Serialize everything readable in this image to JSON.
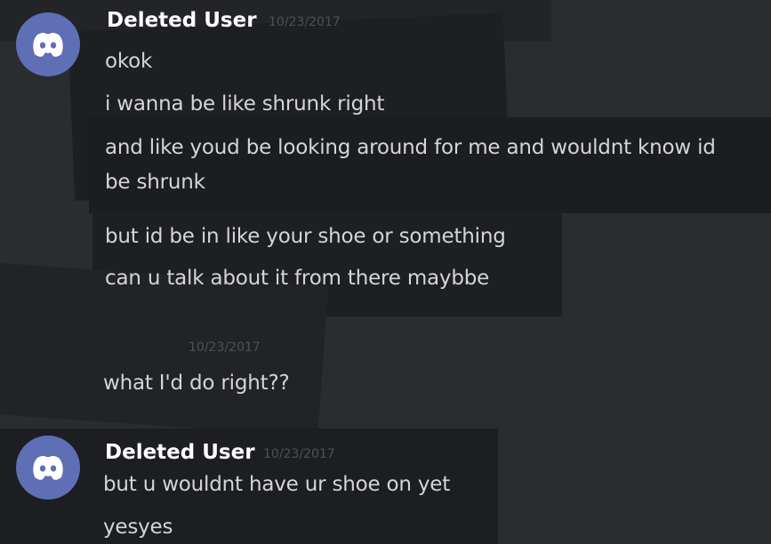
{
  "messages": [
    {
      "author": "Deleted User",
      "timestamp": "10/23/2017",
      "lines": [
        "okok",
        "i wanna be like shrunk right",
        "and like youd be looking around for me and wouldnt know id",
        "be shrunk",
        "but id be in like your shoe or something",
        "can u talk about it from there maybbe"
      ]
    },
    {
      "author": "",
      "timestamp": "10/23/2017",
      "lines": [
        "what I'd do right??"
      ]
    },
    {
      "author": "Deleted User",
      "timestamp": "10/23/2017",
      "lines": [
        "but u wouldnt have ur shoe on yet",
        "yesyes"
      ]
    }
  ],
  "avatar_icon": "discord-logo-icon",
  "colors": {
    "background": "#2b2c30",
    "avatar": "#5f6fb6",
    "username": "#ffffff",
    "message_text": "#d4d5d8",
    "timestamp": "#4e5058"
  }
}
